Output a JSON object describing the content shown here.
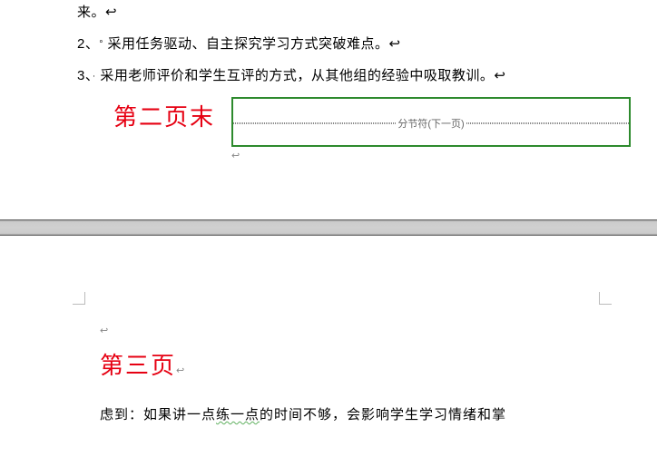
{
  "page_top": {
    "fragment": "来。↩",
    "list": [
      {
        "number": "2、",
        "text": "采用任务驱动、自主探究学习方式突破难点。↩"
      },
      {
        "number": "3、",
        "text": "采用老师评价和学生互评的方式，从其他组的经验中吸取教训。↩"
      }
    ],
    "red_label": "第二页末",
    "section_break_text": "分节符(下一页)"
  },
  "page_bottom": {
    "red_label": "第三页",
    "body_line1_prefix": "虑到：如果讲一点",
    "body_line1_wavy": "练一点",
    "body_line1_suffix": "的时间不够，会影响学生学习情绪和掌"
  }
}
